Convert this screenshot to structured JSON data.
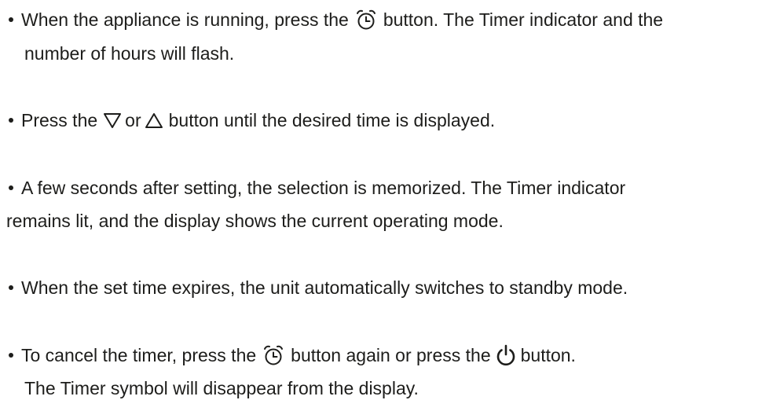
{
  "items": [
    {
      "line1": {
        "before": "When the appliance is running, press the",
        "after": "button. The Timer indicator and the"
      },
      "line2": "number of hours will flash."
    },
    {
      "line1": {
        "before": "Press the",
        "middle": "or",
        "after": "button until the desired time is displayed."
      }
    },
    {
      "line1": "A few seconds after setting, the selection is memorized. The Timer indicator",
      "line2": "remains lit, and the display shows the current operating mode."
    },
    {
      "line1": "When the set time expires, the unit automatically switches to standby mode."
    },
    {
      "line1": {
        "before": "To cancel the timer, press the",
        "middle": "button again or press the",
        "after": "button."
      },
      "line2": "The Timer symbol will disappear from the display."
    }
  ],
  "icons": {
    "timer": "alarm-clock-icon",
    "down": "down-triangle-icon",
    "up": "up-triangle-icon",
    "power": "power-icon"
  }
}
